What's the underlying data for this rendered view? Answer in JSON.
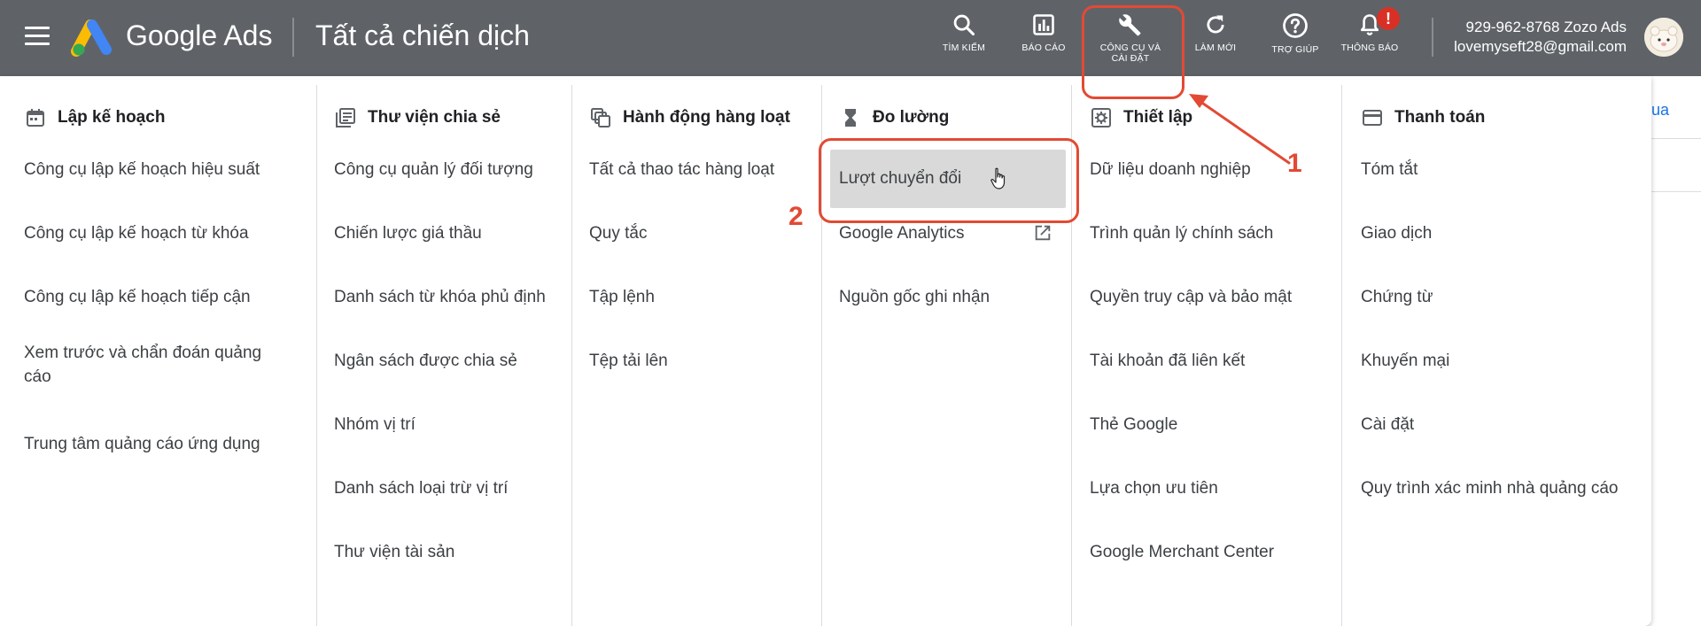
{
  "header": {
    "brand": "Google Ads",
    "page_title": "Tất cả chiến dịch",
    "buttons": {
      "search": "TÌM KIẾM",
      "reports": "BÁO CÁO",
      "tools": "CÔNG CỤ VÀ CÀI ĐẶT",
      "refresh": "LÀM MỚI",
      "help": "TRỢ GIÚP",
      "notifications": "THÔNG BÁO"
    },
    "notif_badge": "!",
    "account_phone": "929-962-8768 Zozo Ads",
    "account_email": "lovemyseft28@gmail.com"
  },
  "menu": {
    "planning": {
      "title": "Lập kế hoạch",
      "items": [
        "Công cụ lập kế hoạch hiệu suất",
        "Công cụ lập kế hoạch từ khóa",
        "Công cụ lập kế hoạch tiếp cận",
        "Xem trước và chẩn đoán quảng cáo",
        "Trung tâm quảng cáo ứng dụng"
      ]
    },
    "shared_library": {
      "title": "Thư viện chia sẻ",
      "items": [
        "Công cụ quản lý đối tượng",
        "Chiến lược giá thầu",
        "Danh sách từ khóa phủ định",
        "Ngân sách được chia sẻ",
        "Nhóm vị trí",
        "Danh sách loại trừ vị trí",
        "Thư viện tài sản"
      ]
    },
    "bulk_actions": {
      "title": "Hành động hàng loạt",
      "items": [
        "Tất cả thao tác hàng loạt",
        "Quy tắc",
        "Tập lệnh",
        "Tệp tải lên"
      ]
    },
    "measurement": {
      "title": "Đo lường",
      "items": [
        "Lượt chuyển đổi",
        "Google Analytics",
        "Nguồn gốc ghi nhận"
      ]
    },
    "setup": {
      "title": "Thiết lập",
      "items": [
        "Dữ liệu doanh nghiệp",
        "Trình quản lý chính sách",
        "Quyền truy cập và bảo mật",
        "Tài khoản đã liên kết",
        "Thẻ Google",
        "Lựa chọn ưu tiên",
        "Google Merchant Center"
      ]
    },
    "billing": {
      "title": "Thanh toán",
      "items": [
        "Tóm tắt",
        "Giao dịch",
        "Chứng từ",
        "Khuyến mại",
        "Cài đặt",
        "Quy trình xác minh nhà quảng cáo"
      ]
    }
  },
  "annotations": {
    "step1": "1",
    "step2": "2",
    "accent": "#e24a34"
  },
  "background_peek": "ua",
  "icons": [
    "menu-icon",
    "google-ads-logo",
    "search-icon",
    "reports-icon",
    "wrench-icon",
    "refresh-icon",
    "help-icon",
    "bell-icon",
    "calendar-icon",
    "library-icon",
    "copy-icon",
    "hourglass-icon",
    "gear-icon",
    "credit-card-icon",
    "external-link-icon",
    "hand-cursor-icon"
  ]
}
